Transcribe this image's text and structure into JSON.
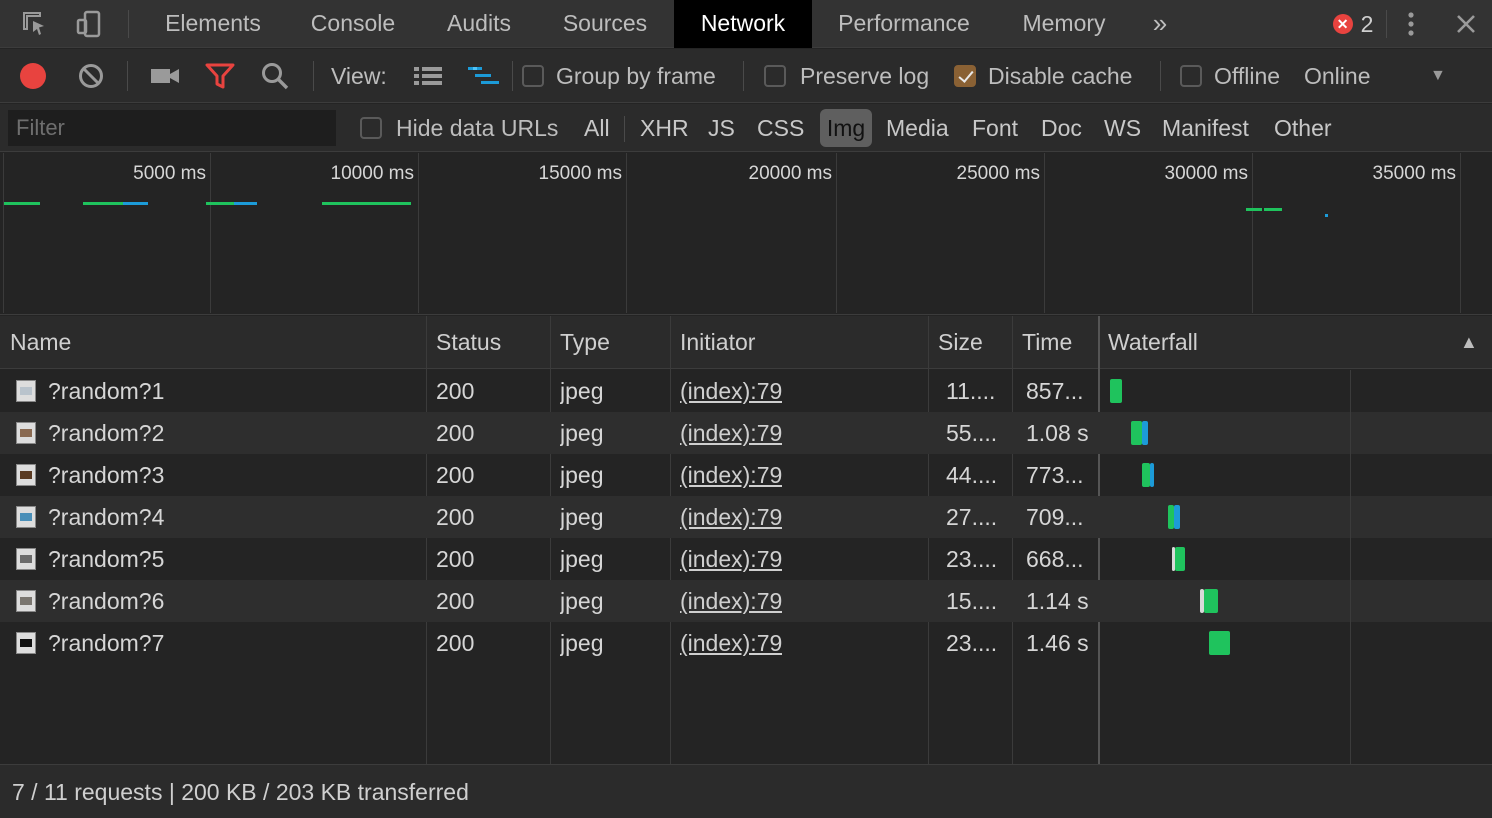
{
  "tabs": [
    "Elements",
    "Console",
    "Audits",
    "Sources",
    "Network",
    "Performance",
    "Memory"
  ],
  "active_tab": "Network",
  "more_tabs": "»",
  "error_count": "2",
  "toolbar": {
    "view_label": "View:",
    "group_by_frame": "Group by frame",
    "preserve_log": "Preserve log",
    "disable_cache": "Disable cache",
    "offline": "Offline",
    "throttle": "Online"
  },
  "filter": {
    "placeholder": "Filter",
    "hide_data_urls": "Hide data URLs",
    "types": [
      "All",
      "XHR",
      "JS",
      "CSS",
      "Img",
      "Media",
      "Font",
      "Doc",
      "WS",
      "Manifest",
      "Other"
    ],
    "active_type": "Img"
  },
  "overview": {
    "ticks": [
      "5000 ms",
      "10000 ms",
      "15000 ms",
      "20000 ms",
      "25000 ms",
      "30000 ms",
      "35000 ms"
    ]
  },
  "columns": [
    "Name",
    "Status",
    "Type",
    "Initiator",
    "Size",
    "Time",
    "Waterfall"
  ],
  "sort_indicator": "▲",
  "requests": [
    {
      "name": "?random?1",
      "status": "200",
      "type": "jpeg",
      "initiator": "(index):79",
      "size": "11....",
      "time": "857..."
    },
    {
      "name": "?random?2",
      "status": "200",
      "type": "jpeg",
      "initiator": "(index):79",
      "size": "55....",
      "time": "1.08 s"
    },
    {
      "name": "?random?3",
      "status": "200",
      "type": "jpeg",
      "initiator": "(index):79",
      "size": "44....",
      "time": "773..."
    },
    {
      "name": "?random?4",
      "status": "200",
      "type": "jpeg",
      "initiator": "(index):79",
      "size": "27....",
      "time": "709..."
    },
    {
      "name": "?random?5",
      "status": "200",
      "type": "jpeg",
      "initiator": "(index):79",
      "size": "23....",
      "time": "668..."
    },
    {
      "name": "?random?6",
      "status": "200",
      "type": "jpeg",
      "initiator": "(index):79",
      "size": "15....",
      "time": "1.14 s"
    },
    {
      "name": "?random?7",
      "status": "200",
      "type": "jpeg",
      "initiator": "(index):79",
      "size": "23....",
      "time": "1.46 s"
    }
  ],
  "status_bar": "7 / 11 requests | 200 KB / 203 KB transferred",
  "colors": {
    "record": "#e8433f",
    "filter_active": "#e8433f",
    "waterfall_wait": "#1fc35d",
    "waterfall_download": "#1c9bd8",
    "tab_active_bg": "#000000"
  }
}
